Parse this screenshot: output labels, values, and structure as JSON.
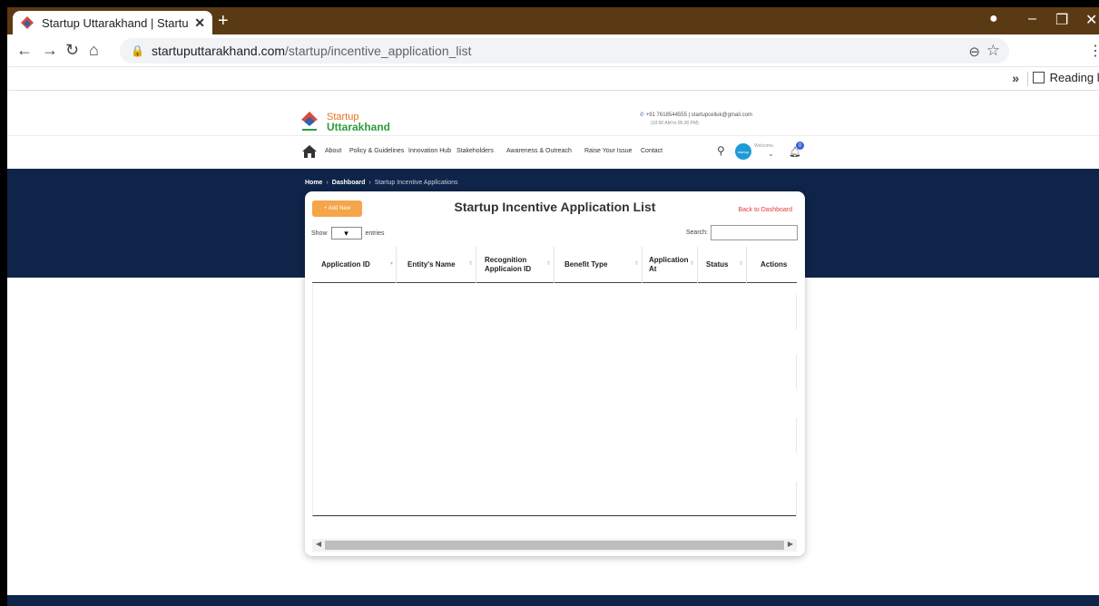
{
  "browser": {
    "tab_title": "Startup Uttarakhand | Startup Re",
    "url_domain": "startuputtarakhand.com",
    "url_path": "/startup/incentive_application_list",
    "reading_list": "Reading lis",
    "bookmarks_more": "»"
  },
  "site": {
    "logo_line1": "Startup",
    "logo_line2": "Uttarakhand",
    "contact_line": "+91 7618544555 | startupcelluk@gmail.com",
    "contact_hours": "(10:00 AM to 05:30 PM)",
    "nav": [
      "About",
      "Policy & Guidelines",
      "Innovation Hub",
      "Stakeholders",
      "Awareness & Outreach",
      "Raise Your Issue",
      "Contact"
    ],
    "welcome": "Welcome,",
    "avatar_text": "startup",
    "notification_count": "0"
  },
  "breadcrumb": {
    "home": "Home",
    "dashboard": "Dashboard",
    "current": "Startup Incentive Applications"
  },
  "card": {
    "add_new": "+ Add New",
    "title": "Startup Incentive Application List",
    "back": "Back to Dashboard",
    "show": "Show",
    "entries": "entries",
    "search_label": "Search:"
  },
  "table": {
    "columns": [
      "Application ID",
      "Entity's Name",
      "Recognition Applicaion ID",
      "Benefit Type",
      "Application At",
      "Status",
      "Actions"
    ]
  }
}
